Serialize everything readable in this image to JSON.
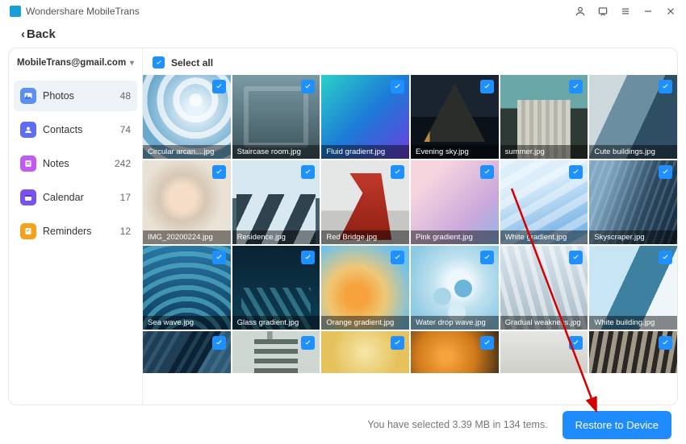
{
  "app": {
    "title": "Wondershare MobileTrans"
  },
  "back": {
    "label": "Back"
  },
  "account": {
    "email": "MobileTrans@gmail.com"
  },
  "sidebar": {
    "items": [
      {
        "label": "Photos",
        "count": "48",
        "icon": "photos-icon",
        "color": "#5c8ff5",
        "selected": true
      },
      {
        "label": "Contacts",
        "count": "74",
        "icon": "contacts-icon",
        "color": "#5d6df5",
        "selected": false
      },
      {
        "label": "Notes",
        "count": "242",
        "icon": "notes-icon",
        "color": "#c25bf0",
        "selected": false
      },
      {
        "label": "Calendar",
        "count": "17",
        "icon": "calendar-icon",
        "color": "#7a52f0",
        "selected": false
      },
      {
        "label": "Reminders",
        "count": "12",
        "icon": "reminders-icon",
        "color": "#f5a11c",
        "selected": false
      }
    ]
  },
  "toolbar": {
    "select_all": "Select all"
  },
  "photos": {
    "items": [
      {
        "file": "Circular arcan....jpg",
        "art": "a1",
        "checked": true
      },
      {
        "file": "Staircase room.jpg",
        "art": "a2",
        "checked": true
      },
      {
        "file": "Fluid gradient.jpg",
        "art": "a3",
        "checked": true
      },
      {
        "file": "Evening sky.jpg",
        "art": "a4",
        "checked": true
      },
      {
        "file": "summer.jpg",
        "art": "a5",
        "checked": true
      },
      {
        "file": "Cute buildings.jpg",
        "art": "a6",
        "checked": true
      },
      {
        "file": "IMG_20200224.jpg",
        "art": "a7",
        "checked": true
      },
      {
        "file": "Residence.jpg",
        "art": "a8",
        "checked": true
      },
      {
        "file": "Red Bridge.jpg",
        "art": "a9",
        "checked": true
      },
      {
        "file": "Pink gradient.jpg",
        "art": "a10",
        "checked": true
      },
      {
        "file": "White gradient.jpg",
        "art": "a11",
        "checked": true
      },
      {
        "file": "Skyscraper.jpg",
        "art": "a12",
        "checked": true
      },
      {
        "file": "Sea wave.jpg",
        "art": "a13",
        "checked": true
      },
      {
        "file": "Glass gradient.jpg",
        "art": "a14",
        "checked": true
      },
      {
        "file": "Orange gradient.jpg",
        "art": "a15",
        "checked": true
      },
      {
        "file": "Water drop wave.jpg",
        "art": "a16",
        "checked": true
      },
      {
        "file": "Gradual weakness.jpg",
        "art": "a17",
        "checked": true
      },
      {
        "file": "White building.jpg",
        "art": "a18",
        "checked": true
      },
      {
        "file": "",
        "art": "a19",
        "checked": true,
        "partial": true
      },
      {
        "file": "",
        "art": "a20",
        "checked": true,
        "partial": true
      },
      {
        "file": "",
        "art": "a21",
        "checked": true,
        "partial": true
      },
      {
        "file": "",
        "art": "a22",
        "checked": true,
        "partial": true
      },
      {
        "file": "",
        "art": "a23",
        "checked": true,
        "partial": true
      },
      {
        "file": "",
        "art": "a24",
        "checked": true,
        "partial": true
      }
    ]
  },
  "footer": {
    "status": "You have selected 3.39 MB in 134 tems.",
    "restore_label": "Restore to Device"
  },
  "colors": {
    "primary": "#1e8cff",
    "check": "#1e90ff"
  }
}
